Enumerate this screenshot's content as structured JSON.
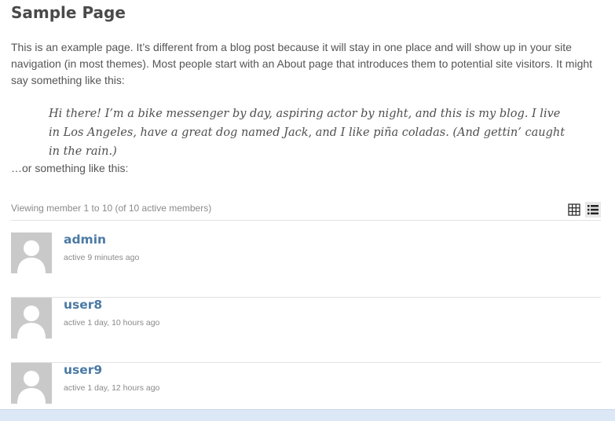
{
  "page": {
    "title": "Sample Page",
    "intro": "This is an example page. It’s different from a blog post because it will stay in one place and will show up in your site navigation (in most themes). Most people start with an About page that introduces them to potential site visitors. It might say something like this:",
    "quote": "Hi there! I’m a bike messenger by day, aspiring actor by night, and this is my blog. I live in Los Angeles, have a great dog named Jack, and I like piña coladas. (And gettin’ caught in the rain.)",
    "outro": "…or something like this:"
  },
  "members": {
    "viewing_text": "Viewing member 1 to 10 (of 10 active members)",
    "view_modes": [
      {
        "icon": "grid-icon",
        "active": false
      },
      {
        "icon": "list-icon",
        "active": true
      }
    ],
    "list": [
      {
        "name": "admin",
        "active": "active 9 minutes ago"
      },
      {
        "name": "user8",
        "active": "active 1 day, 10 hours ago"
      },
      {
        "name": "user9",
        "active": "active 1 day, 12 hours ago"
      }
    ]
  }
}
